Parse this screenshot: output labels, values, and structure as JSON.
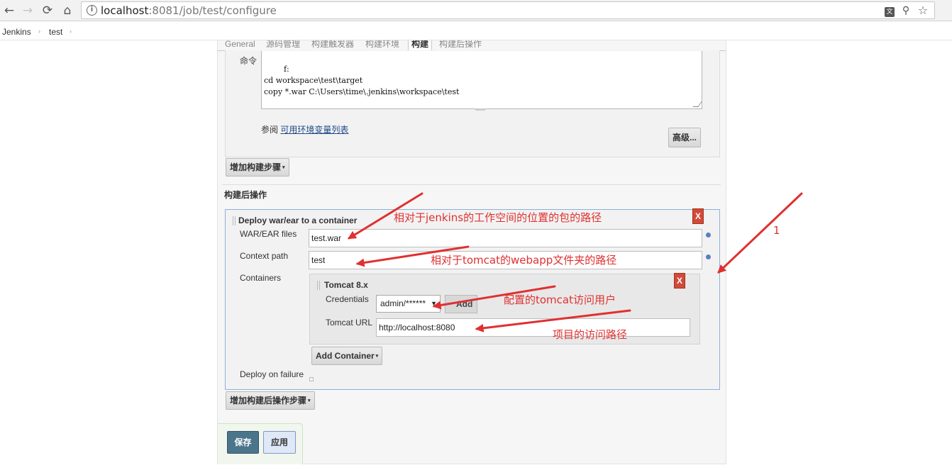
{
  "browser": {
    "url_host": "localhost",
    "url_rest": ":8081/job/test/configure",
    "nav": {
      "back": "←",
      "forward": "→",
      "reload": "⟳",
      "home": "⌂"
    },
    "icons": {
      "info": "i",
      "translate": "文",
      "zoom": "⚲",
      "star": "☆"
    }
  },
  "breadcrumb": {
    "items": [
      "Jenkins",
      "test"
    ],
    "separator": "›"
  },
  "tabs": [
    "General",
    "源码管理",
    "构建触发器",
    "构建环境",
    "构建",
    "构建后操作"
  ],
  "active_tab": "构建",
  "build": {
    "command_label": "命令",
    "command_text": "f:\ncd workspace\\test\\target\ncopy *.war C:\\Users\\time\\.jenkins\\workspace\\test",
    "env_prefix": "参阅 ",
    "env_link": "可用环境变量列表",
    "advanced_button": "高级...",
    "add_step_button": "增加构建步骤"
  },
  "post_build": {
    "section_title": "构建后操作",
    "deploy_title": "Deploy war/ear to a container",
    "close_label": "X",
    "war_label": "WAR/EAR files",
    "war_value": "test.war",
    "context_label": "Context path",
    "context_value": "test",
    "containers_label": "Containers",
    "tomcat_title": "Tomcat 8.x",
    "credentials_label": "Credentials",
    "credentials_value": "admin/******",
    "add_label": "Add",
    "tomcat_url_label": "Tomcat URL",
    "tomcat_url_value": "http://localhost:8080",
    "add_container_button": "Add Container",
    "deploy_failure_label": "Deploy on failure",
    "add_post_step_button": "增加构建后操作步骤"
  },
  "actions": {
    "save": "保存",
    "apply": "应用"
  },
  "annotations": {
    "war_note": "相对于jenkins的工作空间的位置的包的路径",
    "context_note": "相对于tomcat的webapp文件夹的路径",
    "credentials_note": "配置的tomcat访问用户",
    "url_note": "项目的访问路径",
    "number_note": "1",
    "color": "#e03030"
  }
}
